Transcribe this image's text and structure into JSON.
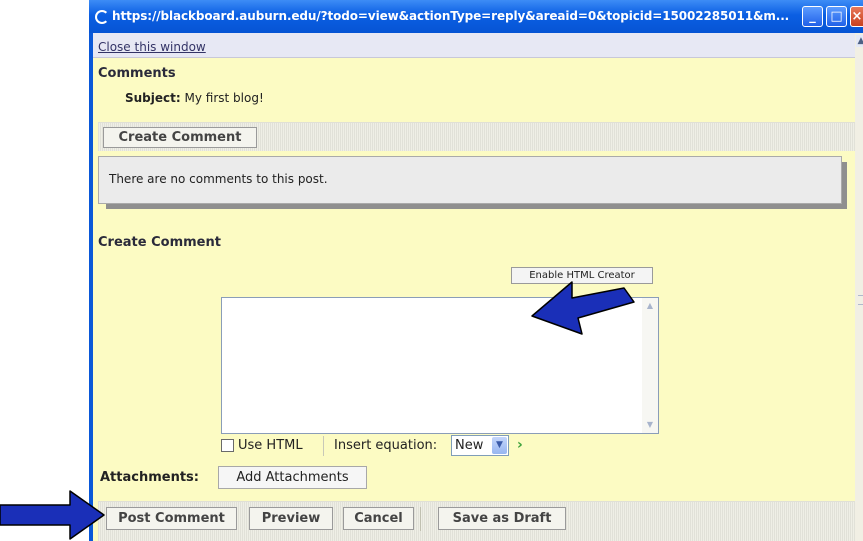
{
  "window": {
    "title": "https://blackboard.auburn.edu/?todo=view&actionType=reply&areaid=0&topicid=15002285011&m...",
    "minimize_glyph": "_",
    "maximize_glyph": "□",
    "close_glyph": "×"
  },
  "page": {
    "close_link": "Close this window",
    "comments_heading": "Comments",
    "subject_label": "Subject:",
    "subject_value": "My first blog!",
    "create_comment_button": "Create Comment",
    "no_comments_text": "There are no comments to this post.",
    "create_comment_heading": "Create Comment",
    "enable_html_button": "Enable HTML Creator",
    "textarea_value": "",
    "use_html_label": "Use HTML",
    "insert_equation_label": "Insert equation:",
    "equation_select_value": "New",
    "attachments_label": "Attachments:",
    "add_attachments_button": "Add Attachments",
    "post_comment_button": "Post Comment",
    "preview_button": "Preview",
    "cancel_button": "Cancel",
    "save_draft_button": "Save as Draft"
  },
  "colors": {
    "page_background": "#fcfbc3",
    "titlebar": "#0b5fe3",
    "annotation_arrow": "#1a2fb8"
  }
}
